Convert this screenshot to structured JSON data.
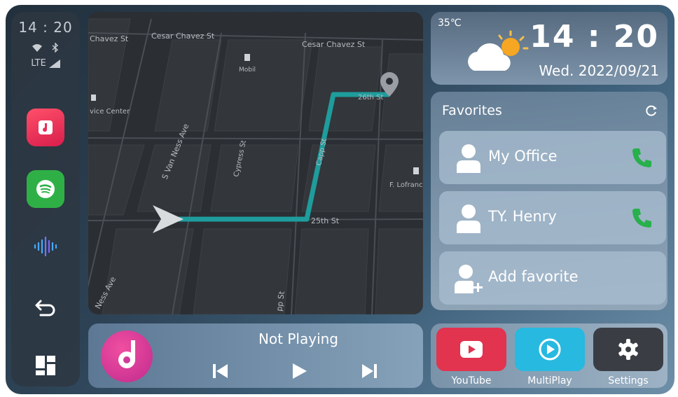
{
  "status_bar": {
    "time": "14 : 20",
    "network": "LTE"
  },
  "rail": {
    "apps": [
      {
        "name": "Music",
        "icon": "music-note-icon",
        "color": "#e83058"
      },
      {
        "name": "Spotify",
        "icon": "spotify-icon",
        "color": "#2fb046"
      }
    ],
    "siri_icon": "siri-waveform-icon",
    "back_icon": "back-arrow-icon",
    "dashboard_icon": "dashboard-icon"
  },
  "map": {
    "streets": {
      "cesar_chavez_left": "Chavez St",
      "cesar_chavez_mid": "Cesar Chavez St",
      "cesar_chavez_right": "Cesar Chavez St",
      "mobil": "Mobil",
      "service_center": "vice Center",
      "van_ness": "S Van Ness Ave",
      "cypress": "Cypress St",
      "capp": "Capp St",
      "f_lofranco": "F. Lofranc",
      "twentyfifth": "25th St",
      "twentysixth": "26th St",
      "ness_ave": "Ness Ave",
      "pp_st": "pp St"
    },
    "route_color": "#1f9c9c"
  },
  "player": {
    "title": "Not Playing",
    "accent": "#d23a9a"
  },
  "clock": {
    "temperature": "35℃",
    "time": "14 : 20",
    "date": "Wed. 2022/09/21"
  },
  "favorites": {
    "title": "Favorites",
    "items": [
      {
        "label": "My Office",
        "has_call": true
      },
      {
        "label": "TY. Henry",
        "has_call": true
      },
      {
        "label": "Add favorite",
        "has_call": false
      }
    ],
    "phone_color": "#27b04b"
  },
  "dock": [
    {
      "label": "YouTube",
      "color": "#e2334f"
    },
    {
      "label": "MultiPlay",
      "color": "#27b9e0"
    },
    {
      "label": "Settings",
      "color": "#3a3e44"
    }
  ]
}
